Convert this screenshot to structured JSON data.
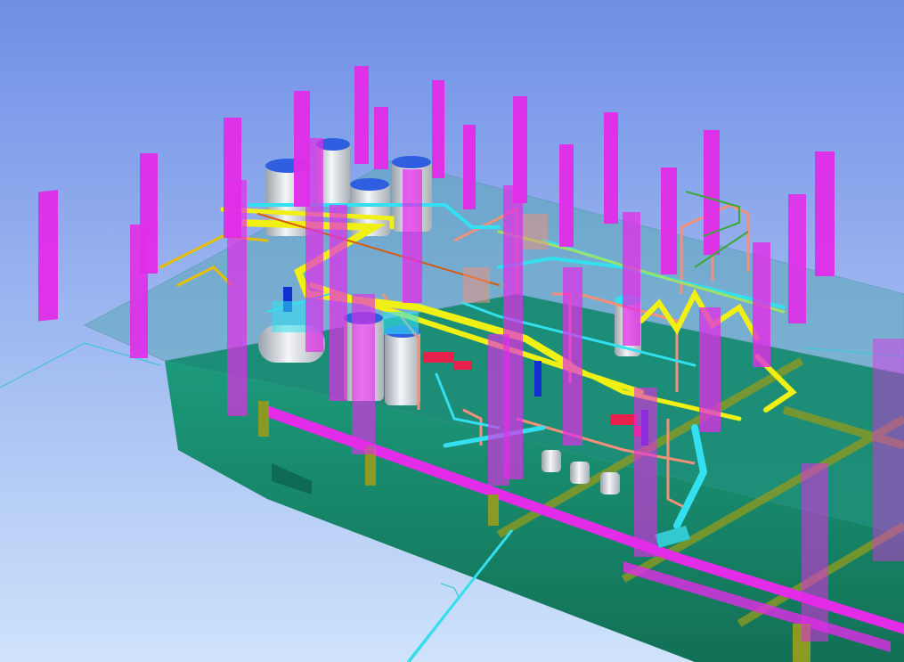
{
  "scene": {
    "kind": "3d-plant-model-viewport",
    "colors": {
      "sky_top": "#6f8fe6",
      "sky_bottom": "#cfe3fb",
      "deck_green": "#1b8a6e",
      "deck_dark": "#0f6a55",
      "glass_plate": "#5aa7b6",
      "columns": "#e22ce8",
      "pipe_yellow": "#f0f014",
      "pipe_cyan": "#33e0f0",
      "pipe_salmon": "#f4907a",
      "vessel_grey": "#d9dde2",
      "vessel_cap": "#2f5fe0",
      "beam_olive": "#8a9a23",
      "accent_red": "#e6204a",
      "accent_blue": "#1030d0"
    },
    "icons": [
      "vertical-column",
      "storage-vessel",
      "horizontal-tank",
      "pump-unit",
      "pipe-rack",
      "walkway-stair"
    ]
  }
}
